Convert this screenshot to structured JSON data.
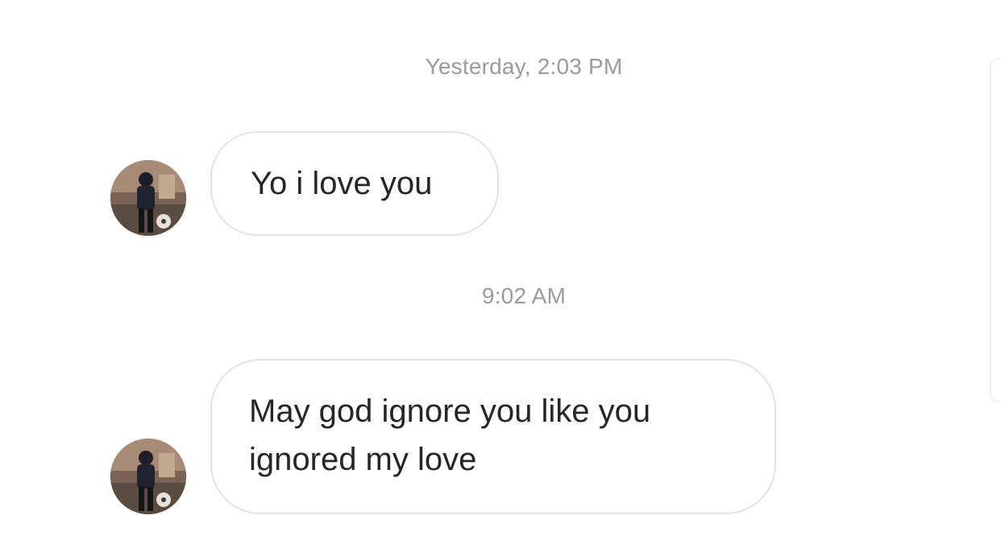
{
  "conversation": {
    "messages": [
      {
        "timestamp": "Yesterday, 2:03 PM",
        "text": "Yo i love you",
        "avatar_icon": "user-avatar-photo"
      },
      {
        "timestamp": "9:02 AM",
        "text": "May god ignore you like you ignored my love",
        "avatar_icon": "user-avatar-photo"
      }
    ]
  },
  "colors": {
    "timestamp": "#9b9b9b",
    "bubble_border": "#e3e3e3",
    "message_text": "#262626",
    "background": "#ffffff"
  }
}
